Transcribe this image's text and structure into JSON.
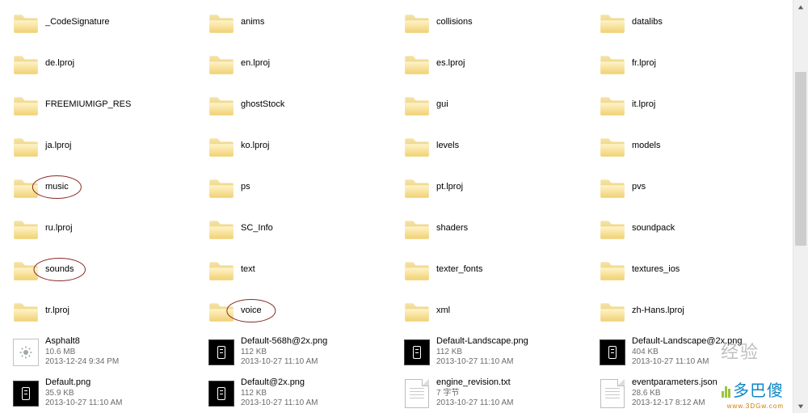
{
  "items": [
    {
      "type": "folder",
      "name": "_CodeSignature"
    },
    {
      "type": "folder",
      "name": "anims"
    },
    {
      "type": "folder",
      "name": "collisions"
    },
    {
      "type": "folder",
      "name": "datalibs"
    },
    {
      "type": "folder",
      "name": "de.lproj"
    },
    {
      "type": "folder",
      "name": "en.lproj"
    },
    {
      "type": "folder",
      "name": "es.lproj"
    },
    {
      "type": "folder",
      "name": "fr.lproj"
    },
    {
      "type": "folder",
      "name": "FREEMIUMIGP_RES"
    },
    {
      "type": "folder",
      "name": "ghostStock"
    },
    {
      "type": "folder",
      "name": "gui"
    },
    {
      "type": "folder",
      "name": "it.lproj"
    },
    {
      "type": "folder",
      "name": "ja.lproj"
    },
    {
      "type": "folder",
      "name": "ko.lproj"
    },
    {
      "type": "folder",
      "name": "levels"
    },
    {
      "type": "folder",
      "name": "models"
    },
    {
      "type": "folder",
      "name": "music",
      "circled": true
    },
    {
      "type": "folder",
      "name": "ps"
    },
    {
      "type": "folder",
      "name": "pt.lproj"
    },
    {
      "type": "folder",
      "name": "pvs"
    },
    {
      "type": "folder",
      "name": "ru.lproj"
    },
    {
      "type": "folder",
      "name": "SC_Info"
    },
    {
      "type": "folder",
      "name": "shaders"
    },
    {
      "type": "folder",
      "name": "soundpack"
    },
    {
      "type": "folder",
      "name": "sounds",
      "circled": true
    },
    {
      "type": "folder",
      "name": "text"
    },
    {
      "type": "folder",
      "name": "texter_fonts"
    },
    {
      "type": "folder",
      "name": "textures_ios"
    },
    {
      "type": "folder",
      "name": "tr.lproj"
    },
    {
      "type": "folder",
      "name": "voice",
      "circled": true
    },
    {
      "type": "folder",
      "name": "xml"
    },
    {
      "type": "folder",
      "name": "zh-Hans.lproj"
    },
    {
      "type": "cfg",
      "name": "Asphalt8",
      "size": "10.6 MB",
      "date": "2013-12-24 9:34 PM"
    },
    {
      "type": "png-black",
      "name": "Default-568h@2x.png",
      "size": "112 KB",
      "date": "2013-10-27 11:10 AM"
    },
    {
      "type": "png-black",
      "name": "Default-Landscape.png",
      "size": "112 KB",
      "date": "2013-10-27 11:10 AM"
    },
    {
      "type": "png-black",
      "name": "Default-Landscape@2x.png",
      "size": "404 KB",
      "date": "2013-10-27 11:10 AM"
    },
    {
      "type": "png-black",
      "name": "Default.png",
      "size": "35.9 KB",
      "date": "2013-10-27 11:10 AM"
    },
    {
      "type": "png-black",
      "name": "Default@2x.png",
      "size": "112 KB",
      "date": "2013-10-27 11:10 AM"
    },
    {
      "type": "txt",
      "name": "engine_revision.txt",
      "size": "7 字节",
      "date": "2013-10-27 11:10 AM"
    },
    {
      "type": "txt",
      "name": "eventparameters.json",
      "size": "28.6 KB",
      "date": "2013-12-17 8:12 AM"
    }
  ],
  "watermark": {
    "brand": "多巴傻",
    "site": "www.3DGw.com"
  },
  "watermark_faint": "经验"
}
